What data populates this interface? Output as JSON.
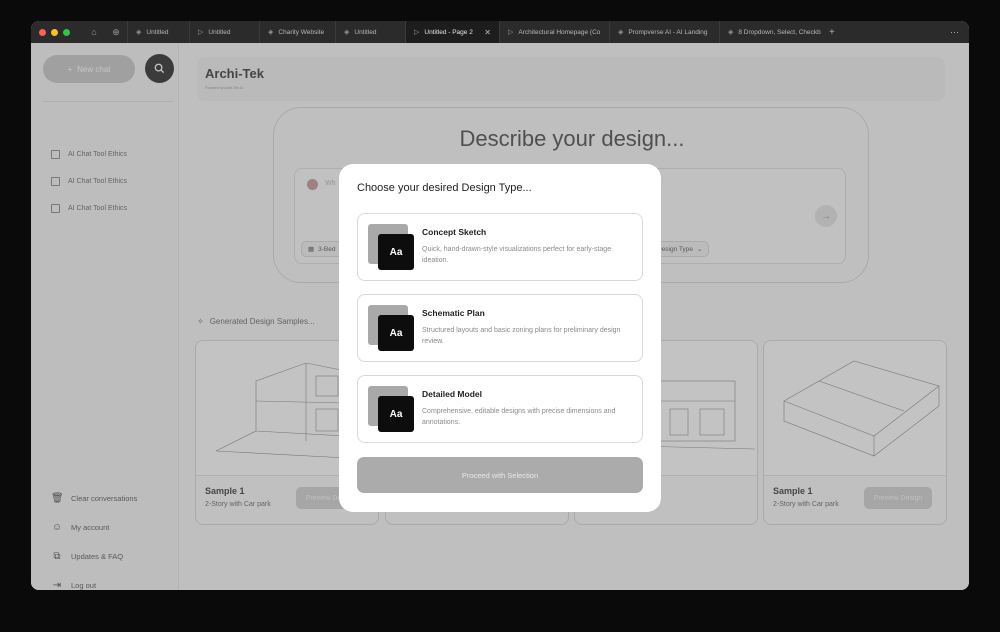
{
  "tabs": [
    {
      "label": "Untitled",
      "active": false
    },
    {
      "label": "Untitled",
      "active": false
    },
    {
      "label": "Charity Website",
      "active": false
    },
    {
      "label": "Untitled",
      "active": false
    },
    {
      "label": "Untitled - Page 2",
      "active": true
    },
    {
      "label": "Architectural Homepage (Co",
      "active": false
    },
    {
      "label": "Prompverse AI - AI Landing",
      "active": false
    },
    {
      "label": "8 Dropdown, Select, Checkb",
      "active": false
    }
  ],
  "sidebar": {
    "new_chat": "New chat",
    "history": [
      "AI Chat Tool Ethics",
      "AI Chat Tool Ethics",
      "AI Chat Tool Ethics"
    ],
    "footer": [
      {
        "label": "Clear conversations",
        "icon": "trash-icon"
      },
      {
        "label": "My account",
        "icon": "user-icon"
      },
      {
        "label": "Updates & FAQ",
        "icon": "external-link-icon"
      },
      {
        "label": "Log out",
        "icon": "logout-icon"
      }
    ]
  },
  "header": {
    "brand": "Archi-Tek",
    "sub": "Powered by Archi-Tek AI"
  },
  "hero": {
    "title": "Describe your design...",
    "placeholder": "Wh",
    "chip_left": "3-Bed",
    "chip_right": "Design Type"
  },
  "samples": {
    "title": "Generated Design Samples...",
    "cards": [
      {
        "title": "Sample 1",
        "subtitle": "2-Story with Car park",
        "button": "Preview Design"
      },
      {
        "title": "Sample 1",
        "subtitle": "2-Story with Car park",
        "button": "Preview Design"
      }
    ]
  },
  "modal": {
    "title": "Choose your desired Design Type...",
    "options": [
      {
        "thumb": "Aa",
        "title": "Concept Sketch",
        "desc": "Quick, hand-drawn-style visualizations perfect for early-stage ideation."
      },
      {
        "thumb": "Aa",
        "title": "Schematic Plan",
        "desc": "Structured layouts and basic zoning plans for preliminary design review."
      },
      {
        "thumb": "Aa",
        "title": "Detailed Model",
        "desc": "Comprehensive, editable designs with precise dimensions and annotations."
      }
    ],
    "proceed": "Proceed with Selection"
  }
}
